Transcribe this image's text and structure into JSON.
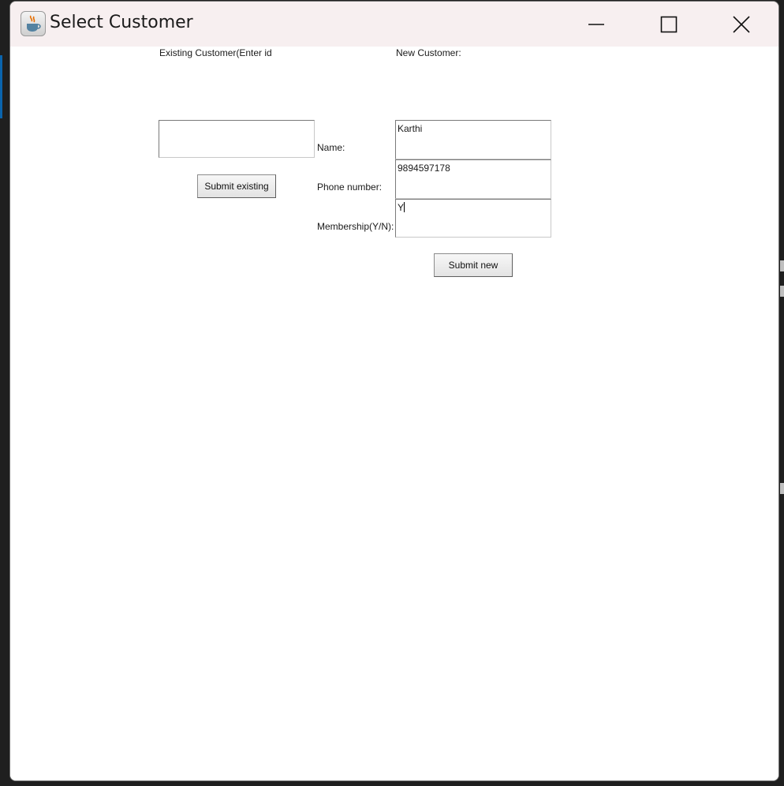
{
  "window": {
    "title": "Select Customer",
    "icons": {
      "app": "java-coffee-cup-icon",
      "minimize": "minimize-icon",
      "maximize": "maximize-icon",
      "close": "close-icon"
    }
  },
  "existing": {
    "header": "Existing Customer(Enter id",
    "id_value": "",
    "submit_label": "Submit existing"
  },
  "new_customer": {
    "header": "New Customer:",
    "name_label": "Name:",
    "name_value": "Karthi",
    "phone_label": "Phone number:",
    "phone_value": "9894597178",
    "membership_label": "Membership(Y/N):",
    "membership_value": "Y",
    "submit_label": "Submit new"
  }
}
